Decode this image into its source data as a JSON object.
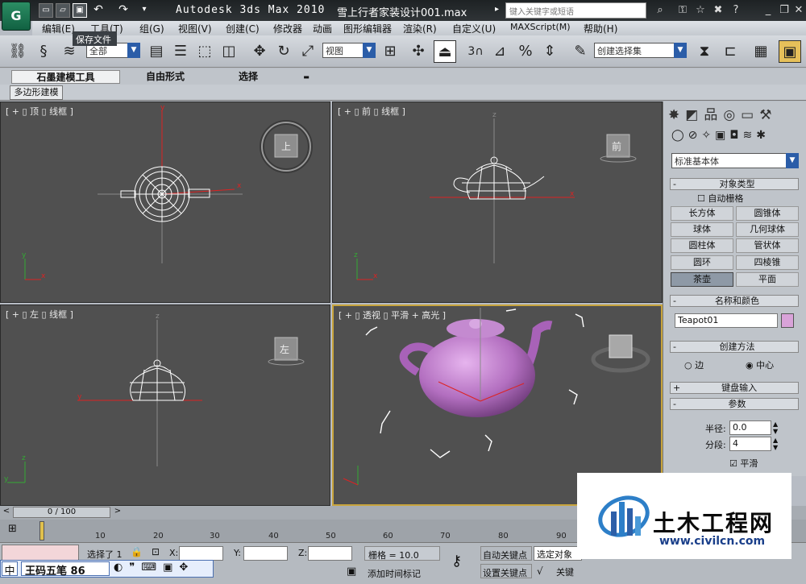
{
  "app": {
    "logo": "G",
    "title": "Autodesk 3ds Max  2010",
    "file": "雪上行者家装设计001.max",
    "search_placeholder": "键入关键字或短语",
    "tooltip": "保存文件"
  },
  "menu": [
    "编辑(E)",
    "工具(T)",
    "组(G)",
    "视图(V)",
    "创建(C)",
    "修改器",
    "动画",
    "图形编辑器",
    "渲染(R)",
    "自定义(U)",
    "MAXScript(M)",
    "帮助(H)"
  ],
  "toolbar": {
    "filter": "全部",
    "refcoord": "视图",
    "named_selection": "创建选择集",
    "snap_label": "3"
  },
  "ribbon": {
    "tabs": [
      "石墨建模工具",
      "自由形式",
      "选择"
    ],
    "subtab": "多边形建模"
  },
  "viewports": {
    "top": {
      "label": "[ + ▯ 顶 ▯ 线框 ]",
      "cube": "上"
    },
    "front": {
      "label": "[ + ▯ 前 ▯ 线框 ]",
      "cube": "前"
    },
    "left": {
      "label": "[ + ▯ 左 ▯ 线框 ]",
      "cube": "左"
    },
    "persp": {
      "label": "[ + ▯ 透视 ▯ 平滑 + 高光 ]"
    }
  },
  "command_panel": {
    "category": "标准基本体",
    "object_type": {
      "title": "对象类型",
      "autogrid": "自动栅格",
      "buttons": [
        "长方体",
        "圆锥体",
        "球体",
        "几何球体",
        "圆柱体",
        "管状体",
        "圆环",
        "四棱锥",
        "茶壶",
        "平面"
      ]
    },
    "name_color": {
      "title": "名称和颜色",
      "name": "Teapot01",
      "color": "#d9a3d9"
    },
    "creation": {
      "title": "创建方法",
      "edge": "边",
      "center": "中心"
    },
    "keyboard": "键盘输入",
    "params": {
      "title": "参数",
      "radius_label": "半径:",
      "radius": "0.0",
      "segments_label": "分段:",
      "segments": "4",
      "smooth": "平滑"
    }
  },
  "timeline": {
    "position": "0 / 100",
    "ticks": [
      "10",
      "20",
      "30",
      "40",
      "50",
      "60",
      "70",
      "80",
      "90"
    ]
  },
  "status": {
    "selected": "选择了 1",
    "x": "X:",
    "y": "Y:",
    "z": "Z:",
    "grid": "栅格 = 10.0",
    "autokey": "自动关键点",
    "setkey": "设置关键点",
    "selobj": "选定对象",
    "addtime": "添加时间标记",
    "keyfilter": "关键"
  },
  "ime": {
    "mode": "中",
    "name": "王码五笔 86"
  },
  "watermark": {
    "cn": "土木工程网",
    "url": "www.civilcn.com"
  }
}
